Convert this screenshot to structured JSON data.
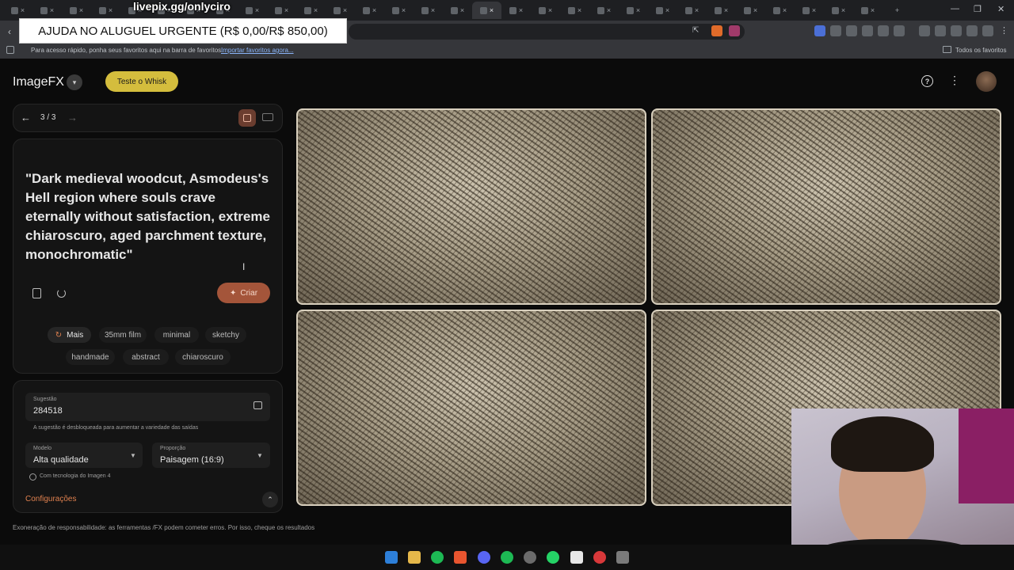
{
  "overlay": {
    "donation_banner": "AJUDA NO ALUGUEL URGENTE (R$ 0,00/R$ 850,00)",
    "stream_link": "livepix.gg/onlyciro"
  },
  "browser": {
    "bookmarks_hint": "Para acesso rápido, ponha seus favoritos aqui na barra de favoritos.",
    "import_link": "Importar favoritos agora...",
    "all_favorites": "Todos os favoritos"
  },
  "app": {
    "brand": "ImageFX",
    "try_whisk": "Teste o Whisk"
  },
  "nav": {
    "page_indicator": "3 / 3"
  },
  "prompt": {
    "text": "\"Dark medieval woodcut, Asmodeus's Hell region where souls crave eternally without satisfaction, extreme chiaroscuro, aged parchment texture, monochromatic\"",
    "create_label": "Criar"
  },
  "chips": {
    "more": "Mais",
    "items": [
      "35mm film",
      "minimal",
      "sketchy",
      "handmade",
      "abstract",
      "chiaroscuro"
    ]
  },
  "settings": {
    "seed_label": "Sugestão",
    "seed_value": "284518",
    "seed_hint": "A sugestão é desbloqueada para aumentar a variedade das saídas",
    "model_label": "Modelo",
    "model_value": "Alta qualidade",
    "ratio_label": "Proporção",
    "ratio_value": "Paisagem (16:9)",
    "powered_by": "Com tecnologia do Imagen 4",
    "config_link": "Configurações"
  },
  "footer": {
    "disclaimer": "Exoneração de responsabilidade: as ferramentas /FX podem cometer erros. Por isso, cheque os resultados"
  },
  "colors": {
    "accent": "#a4553a",
    "whisk": "#d4bd3d",
    "link": "#e0814f"
  }
}
